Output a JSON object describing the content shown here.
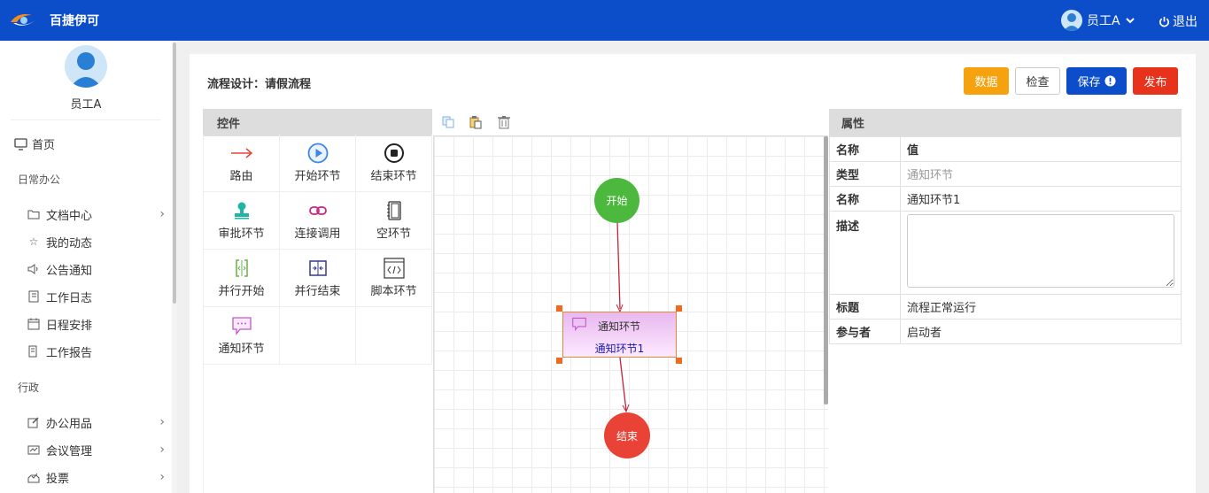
{
  "header": {
    "app_title": "百捷伊可",
    "user_name": "员工A",
    "logout_label": "退出"
  },
  "sidebar": {
    "user_name": "员工A",
    "home_label": "首页",
    "sections": [
      {
        "title": "日常办公",
        "items": [
          {
            "label": "文档中心",
            "icon": "folder-icon",
            "has_children": true
          },
          {
            "label": "我的动态",
            "icon": "star-icon",
            "has_children": false
          },
          {
            "label": "公告通知",
            "icon": "speaker-icon",
            "has_children": false
          },
          {
            "label": "工作日志",
            "icon": "notebook-icon",
            "has_children": false
          },
          {
            "label": "日程安排",
            "icon": "calendar-icon",
            "has_children": false
          },
          {
            "label": "工作报告",
            "icon": "report-icon",
            "has_children": false
          }
        ]
      },
      {
        "title": "行政",
        "items": [
          {
            "label": "办公用品",
            "icon": "edit-icon",
            "has_children": true
          },
          {
            "label": "会议管理",
            "icon": "meeting-icon",
            "has_children": true
          },
          {
            "label": "投票",
            "icon": "vote-icon",
            "has_children": true
          }
        ]
      }
    ]
  },
  "page": {
    "title": "流程设计：请假流程"
  },
  "actions": {
    "data": "数据",
    "check": "检查",
    "save": "保存",
    "publish": "发布"
  },
  "controls": {
    "title": "控件",
    "items": [
      {
        "label": "路由",
        "icon": "arrow-right-icon"
      },
      {
        "label": "开始环节",
        "icon": "play-circle-icon"
      },
      {
        "label": "结束环节",
        "icon": "stop-circle-icon"
      },
      {
        "label": "审批环节",
        "icon": "stamp-icon"
      },
      {
        "label": "连接调用",
        "icon": "link-icon"
      },
      {
        "label": "空环节",
        "icon": "blank-page-icon"
      },
      {
        "label": "并行开始",
        "icon": "parallel-start-icon"
      },
      {
        "label": "并行结束",
        "icon": "parallel-end-icon"
      },
      {
        "label": "脚本环节",
        "icon": "code-icon"
      },
      {
        "label": "通知环节",
        "icon": "message-icon"
      }
    ]
  },
  "canvas": {
    "start_label": "开始",
    "end_label": "结束",
    "node_type": "通知环节",
    "node_name": "通知环节1"
  },
  "properties": {
    "title": "属性",
    "col_name": "名称",
    "col_value": "值",
    "rows": {
      "type": {
        "k": "类型",
        "v": "通知环节"
      },
      "name": {
        "k": "名称",
        "v": "通知环节1"
      },
      "desc": {
        "k": "描述",
        "v": ""
      },
      "subject": {
        "k": "标题",
        "v": "流程正常运行"
      },
      "participant": {
        "k": "参与者",
        "v": "启动者"
      }
    }
  },
  "colors": {
    "brand": "#0c4ec9",
    "data_btn": "#f6a20e",
    "publish_btn": "#e8331c",
    "start_node": "#4cb83e",
    "end_node": "#e84336"
  }
}
